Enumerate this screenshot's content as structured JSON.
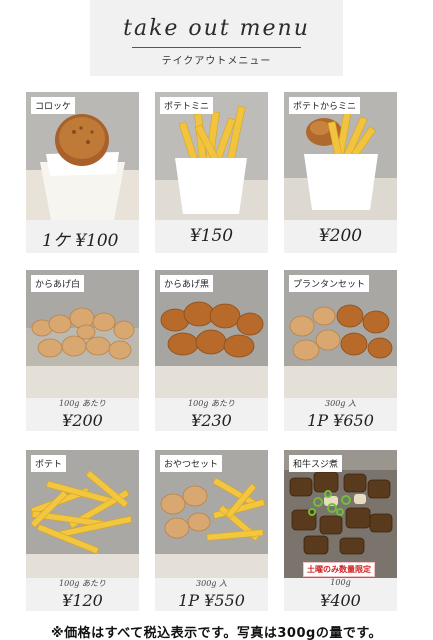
{
  "header": {
    "title_script": "take out menu",
    "title_kana": "テイクアウトメニュー"
  },
  "items": [
    {
      "label": "コロッケ",
      "note": "",
      "price": "1ケ ¥100"
    },
    {
      "label": "ポテトミニ",
      "note": "",
      "price": "¥150"
    },
    {
      "label": "ポテトからミニ",
      "note": "",
      "price": "¥200"
    },
    {
      "label": "からあげ白",
      "note": "100g あたり",
      "price": "¥200"
    },
    {
      "label": "からあげ黒",
      "note": "100g あたり",
      "price": "¥230"
    },
    {
      "label": "プランタンセット",
      "note": "300g 入",
      "price": "1P ¥650"
    },
    {
      "label": "ポテト",
      "note": "100g あたり",
      "price": "¥120"
    },
    {
      "label": "おやつセット",
      "note": "300g 入",
      "price": "1P ¥550"
    },
    {
      "label": "和牛スジ煮",
      "note": "100g",
      "price": "¥400",
      "badge": "土曜のみ数量限定"
    }
  ],
  "footer": {
    "text": "※価格はすべて税込表示です。写真は300gの量です。"
  },
  "colors": {
    "card_bg": "#f1f1f1",
    "badge_red": "#d02020"
  }
}
